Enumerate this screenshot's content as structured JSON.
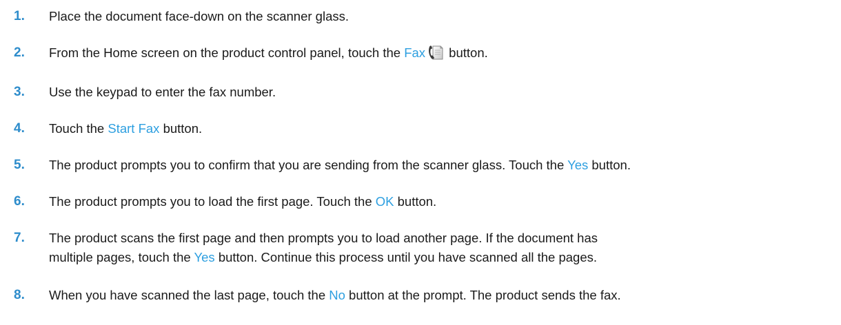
{
  "steps": [
    {
      "number": "1.",
      "text": "Place the document face-down on the scanner glass."
    },
    {
      "number": "2.",
      "before": "From the Home screen on the product control panel, touch the ",
      "ui": "Fax",
      "icon": "fax-icon",
      "after": " button."
    },
    {
      "number": "3.",
      "text": "Use the keypad to enter the fax number."
    },
    {
      "number": "4.",
      "before": "Touch the ",
      "ui": "Start Fax",
      "after": " button."
    },
    {
      "number": "5.",
      "before": "The product prompts you to confirm that you are sending from the scanner glass. Touch the ",
      "ui": "Yes",
      "after": " button."
    },
    {
      "number": "6.",
      "before": "The product prompts you to load the first page. Touch the ",
      "ui": "OK",
      "after": " button."
    },
    {
      "number": "7.",
      "line1": "The product scans the first page and then prompts you to load another page. If the document has",
      "before": "multiple pages, touch the ",
      "ui": "Yes",
      "after": " button. Continue this process until you have scanned all the pages."
    },
    {
      "number": "8.",
      "before": "When you have scanned the last page, touch the ",
      "ui": "No",
      "after": " button at the prompt. The product sends the fax."
    }
  ],
  "colors": {
    "step_number": "#2d8ccb",
    "ui_term": "#2d9fe0",
    "body_text": "#1a1a1a"
  }
}
